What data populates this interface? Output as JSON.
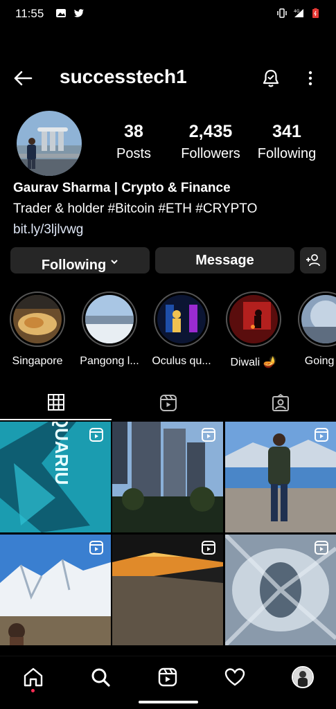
{
  "status_bar": {
    "time": "11:55",
    "icons": [
      "image-icon",
      "twitter-icon",
      "vibrate-icon",
      "signal-4g-icon",
      "battery-icon"
    ]
  },
  "header": {
    "username": "successtech1",
    "icons": [
      "back-arrow-icon",
      "bell-icon",
      "more-vertical-icon"
    ]
  },
  "profile": {
    "posts_count": "38",
    "posts_label": "Posts",
    "followers_count": "2,435",
    "followers_label": "Followers",
    "following_count": "341",
    "following_label": "Following",
    "name": "Gaurav Sharma | Crypto & Finance",
    "bio": "Trader & holder #Bitcoin #ETH #CRYPTO",
    "link": "bit.ly/3ljlvwg"
  },
  "actions": {
    "following_label": "Following",
    "message_label": "Message"
  },
  "highlights": [
    {
      "label": "Singapore"
    },
    {
      "label": "Pangong l..."
    },
    {
      "label": "Oculus qu..."
    },
    {
      "label": "Diwali 🪔"
    },
    {
      "label": "Going to"
    }
  ],
  "tabs": [
    "grid-icon",
    "reels-icon",
    "tagged-icon"
  ],
  "bottom_nav": [
    "home-icon",
    "search-icon",
    "reels-icon",
    "heart-icon",
    "profile-avatar"
  ],
  "colors": {
    "background": "#000000",
    "button": "#262626",
    "notification_dot": "#ff2d55"
  }
}
